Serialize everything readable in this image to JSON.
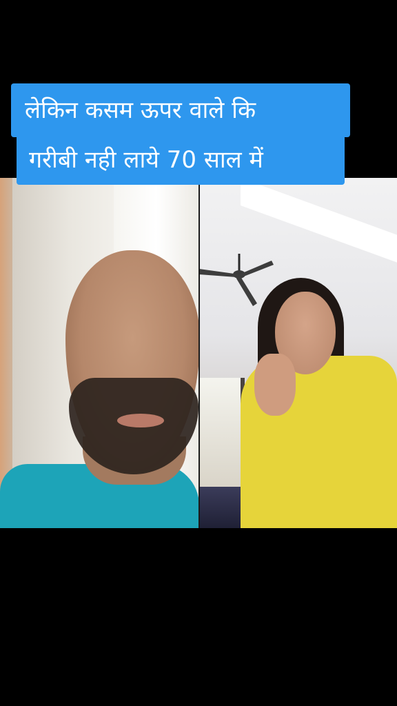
{
  "caption": {
    "line1": "लेकिन कसम ऊपर वाले कि",
    "line2": "गरीबी नही लाये 70 साल में"
  },
  "colors": {
    "caption_background": "#2e97ee",
    "caption_text": "#ffffff",
    "screen_background": "#000000"
  },
  "participants": [
    {
      "name": "participant-left"
    },
    {
      "name": "participant-right"
    }
  ]
}
